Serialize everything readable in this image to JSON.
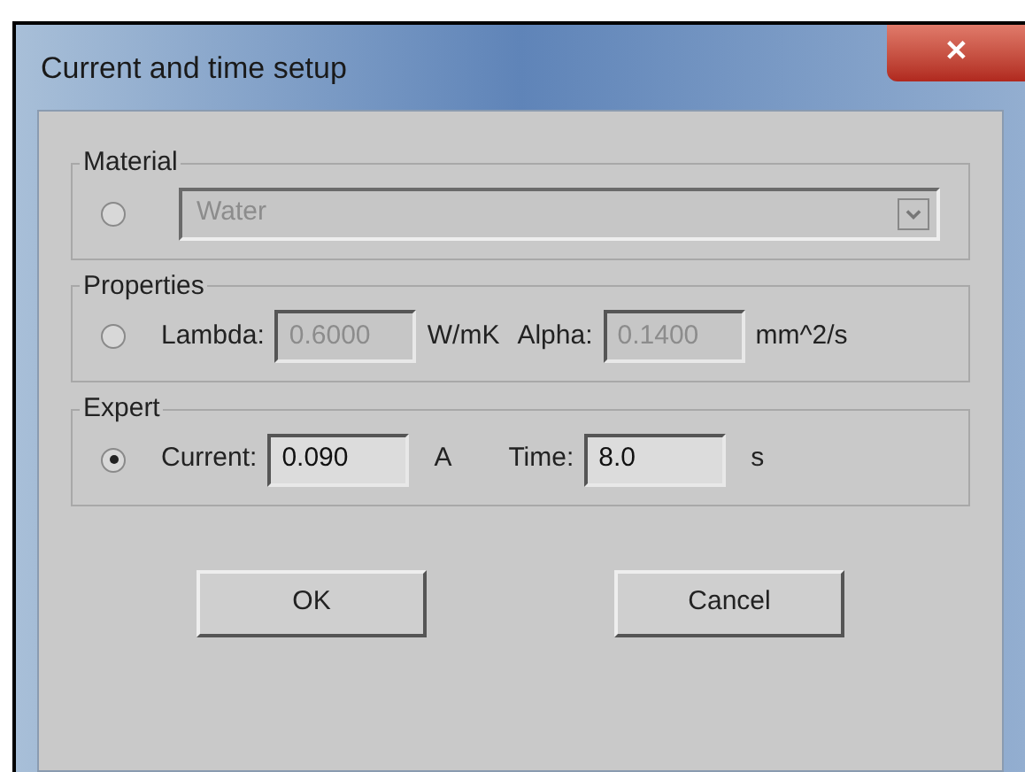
{
  "window": {
    "title": "Current and time setup",
    "close": "✕"
  },
  "groups": [
    {
      "label": "Material",
      "kind": "dropdown",
      "selected": false,
      "dropdown": {
        "value": "Water",
        "disabled": true
      }
    },
    {
      "label": "Properties",
      "kind": "fields",
      "selected": false,
      "fields": [
        {
          "label": "Lambda:",
          "value": "0.6000",
          "unit": "W/mK",
          "disabled": true
        },
        {
          "label": "Alpha:",
          "value": "0.1400",
          "unit": "mm^2/s",
          "disabled": true
        }
      ]
    },
    {
      "label": "Expert",
      "kind": "fields",
      "selected": true,
      "fields": [
        {
          "label": "Current:",
          "value": "0.090",
          "unit": "A",
          "disabled": false
        },
        {
          "label": "Time:",
          "value": "8.0",
          "unit": "s",
          "disabled": false
        }
      ]
    }
  ],
  "buttons": [
    "OK",
    "Cancel"
  ]
}
